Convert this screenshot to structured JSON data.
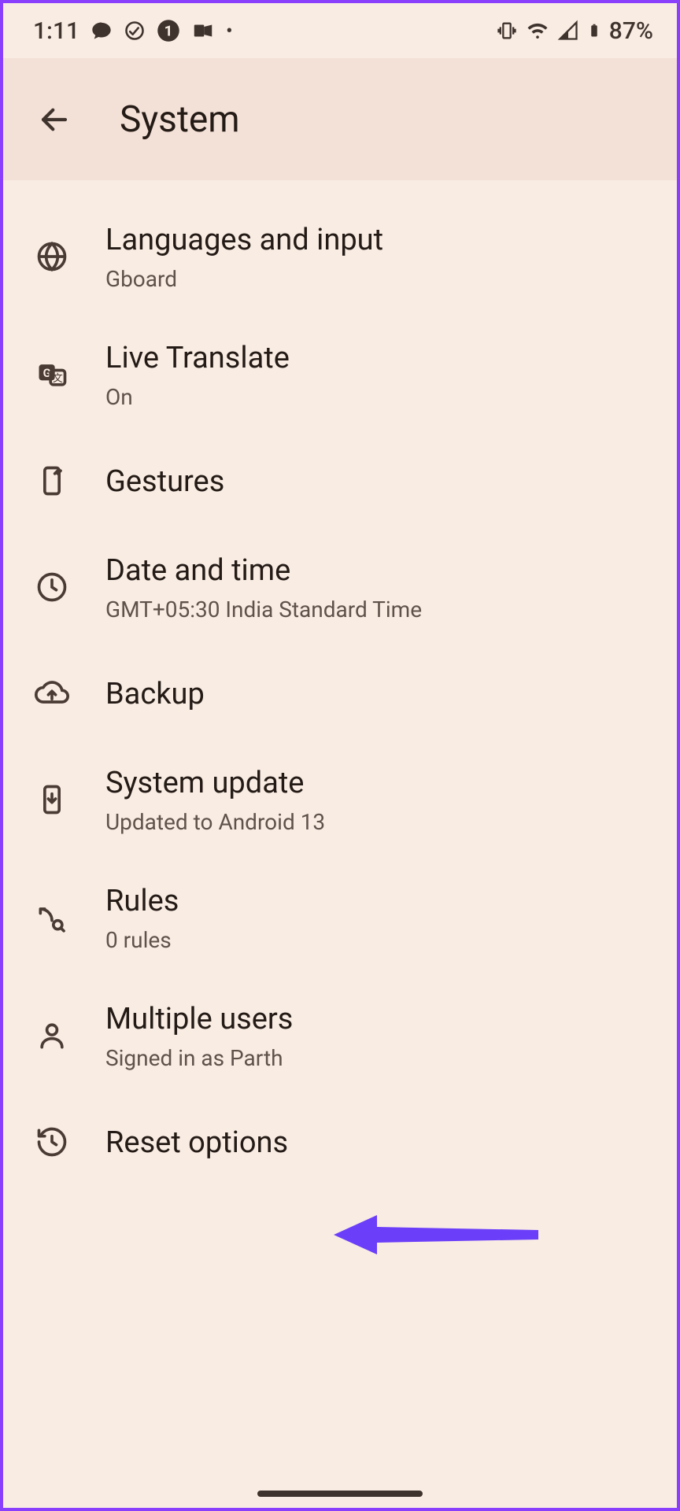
{
  "statusbar": {
    "time": "1:11",
    "battery_text": "87%"
  },
  "appbar": {
    "title": "System"
  },
  "items": [
    {
      "title": "Languages and input",
      "subtitle": "Gboard"
    },
    {
      "title": "Live Translate",
      "subtitle": "On"
    },
    {
      "title": "Gestures",
      "subtitle": ""
    },
    {
      "title": "Date and time",
      "subtitle": "GMT+05:30 India Standard Time"
    },
    {
      "title": "Backup",
      "subtitle": ""
    },
    {
      "title": "System update",
      "subtitle": "Updated to Android 13"
    },
    {
      "title": "Rules",
      "subtitle": "0 rules"
    },
    {
      "title": "Multiple users",
      "subtitle": "Signed in as Parth"
    },
    {
      "title": "Reset options",
      "subtitle": ""
    }
  ],
  "annotation": {
    "color": "#6b3ff9"
  }
}
